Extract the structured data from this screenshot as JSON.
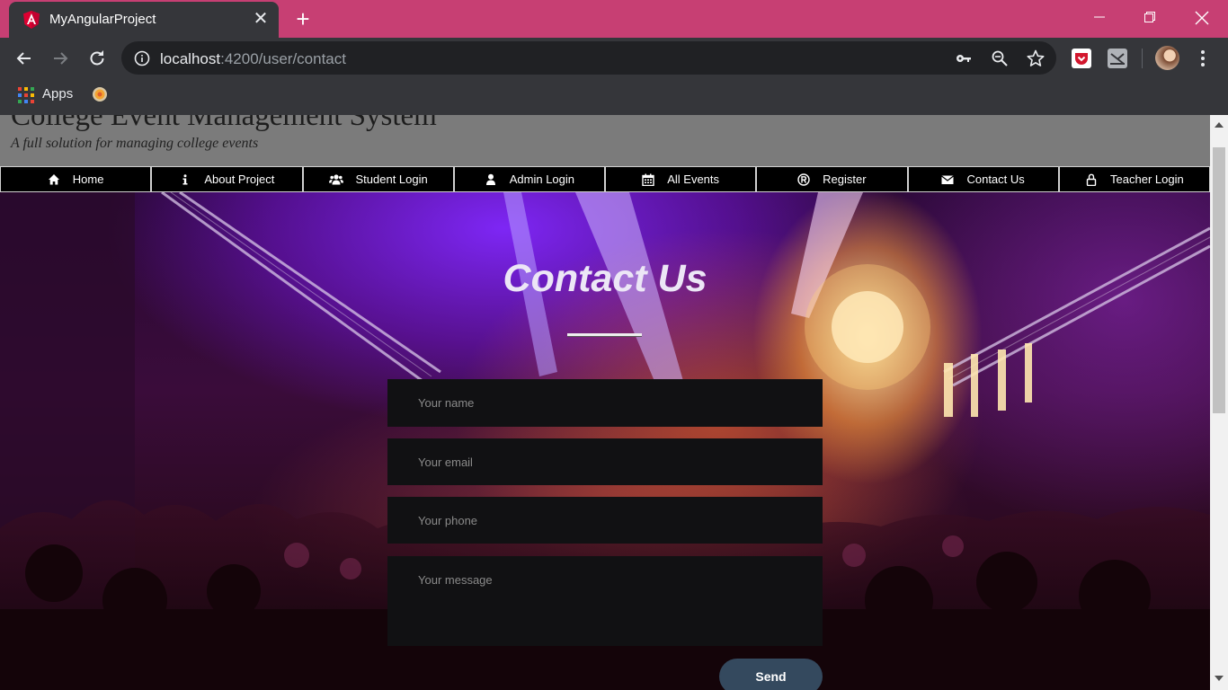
{
  "browser": {
    "tab_title": "MyAngularProject",
    "tab_close": "✕",
    "new_tab": "+",
    "url_host": "localhost",
    "url_rest": ":4200/user/contact",
    "bookmarks": {
      "apps_label": "Apps"
    }
  },
  "site": {
    "title": "College Event Management System",
    "tagline": "A full solution for managing college events"
  },
  "nav": {
    "items": [
      {
        "label": "Home",
        "icon": "home-icon"
      },
      {
        "label": "About Project",
        "icon": "info-icon"
      },
      {
        "label": "Student Login",
        "icon": "users-icon"
      },
      {
        "label": "Admin Login",
        "icon": "user-icon"
      },
      {
        "label": "All Events",
        "icon": "calendar-icon"
      },
      {
        "label": "Register",
        "icon": "registered-icon"
      },
      {
        "label": "Contact Us",
        "icon": "envelope-icon"
      },
      {
        "label": "Teacher Login",
        "icon": "lock-icon"
      }
    ]
  },
  "contact": {
    "heading": "Contact Us",
    "name_placeholder": "Your name",
    "email_placeholder": "Your email",
    "phone_placeholder": "Your phone",
    "message_placeholder": "Your message",
    "send_label": "Send"
  },
  "colors": {
    "titlebar": "#c73f73",
    "chrome": "#35363a",
    "send_button": "#34495e",
    "field_bg": "#111113"
  }
}
